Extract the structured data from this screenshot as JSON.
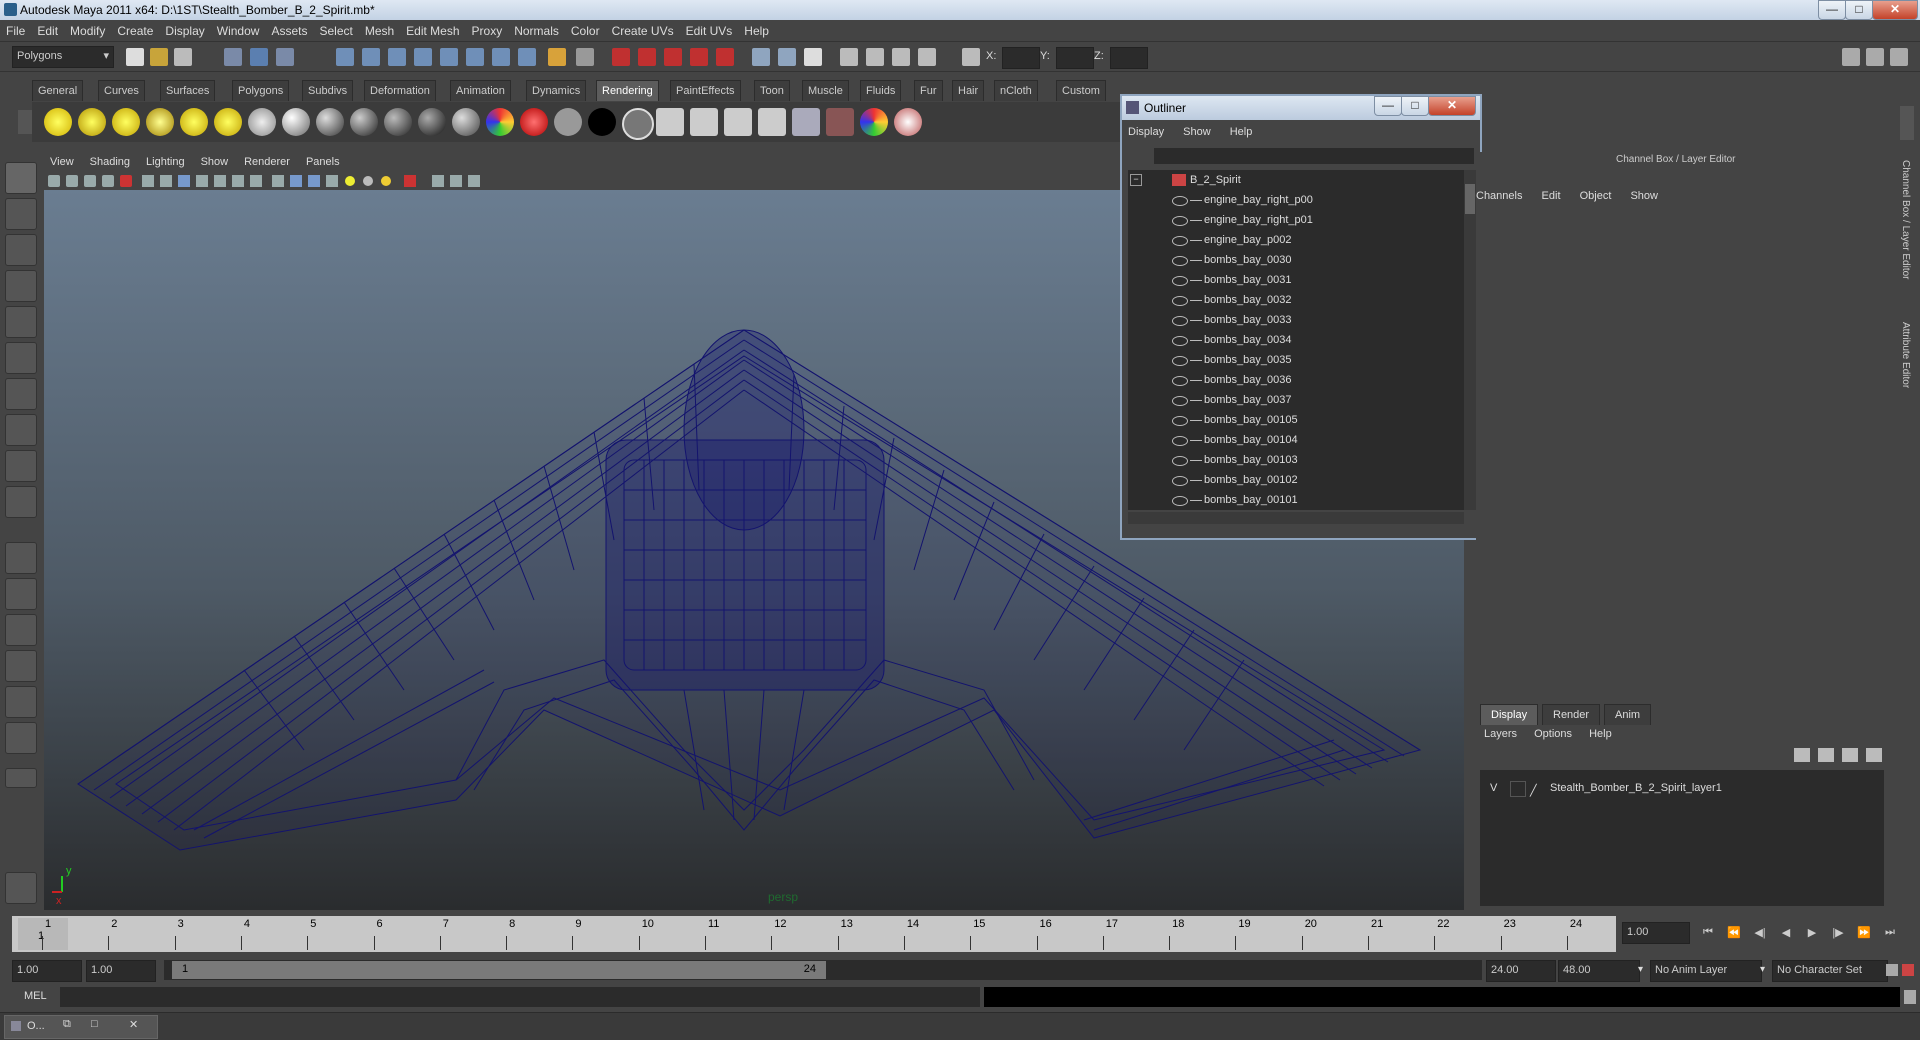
{
  "app": {
    "title": "Autodesk Maya 2011 x64: D:\\1ST\\Stealth_Bomber_B_2_Spirit.mb*",
    "min_label": "—",
    "max_label": "□",
    "close_label": "✕"
  },
  "menubar": [
    "File",
    "Edit",
    "Modify",
    "Create",
    "Display",
    "Window",
    "Assets",
    "Select",
    "Mesh",
    "Edit Mesh",
    "Proxy",
    "Normals",
    "Color",
    "Create UVs",
    "Edit UVs",
    "Help"
  ],
  "statusline": {
    "mode": "Polygons",
    "x_label": "X:",
    "y_label": "Y:",
    "z_label": "Z:"
  },
  "shelf_tabs": [
    "General",
    "Curves",
    "Surfaces",
    "Polygons",
    "Subdivs",
    "Deformation",
    "Animation",
    "Dynamics",
    "Rendering",
    "PaintEffects",
    "Toon",
    "Muscle",
    "Fluids",
    "Fur",
    "Hair",
    "nCloth",
    "Custom"
  ],
  "shelf_active": "Rendering",
  "viewport": {
    "menu": [
      "View",
      "Shading",
      "Lighting",
      "Show",
      "Renderer",
      "Panels"
    ],
    "camera": "persp",
    "axis_x": "x",
    "axis_y": "y"
  },
  "outliner": {
    "title": "Outliner",
    "menu": [
      "Display",
      "Show",
      "Help"
    ],
    "root": "B_2_Spirit",
    "items": [
      "engine_bay_right_p00",
      "engine_bay_right_p01",
      "engine_bay_p002",
      "bombs_bay_0030",
      "bombs_bay_0031",
      "bombs_bay_0032",
      "bombs_bay_0033",
      "bombs_bay_0034",
      "bombs_bay_0035",
      "bombs_bay_0036",
      "bombs_bay_0037",
      "bombs_bay_00105",
      "bombs_bay_00104",
      "bombs_bay_00103",
      "bombs_bay_00102",
      "bombs_bay_00101"
    ]
  },
  "channel_box": {
    "header": "Channel Box / Layer Editor",
    "menu": [
      "Channels",
      "Edit",
      "Object",
      "Show"
    ],
    "side_tabs": [
      "Channel Box / Layer Editor",
      "Attribute Editor"
    ]
  },
  "layer_editor": {
    "tabs": [
      "Display",
      "Render",
      "Anim"
    ],
    "active_tab": "Display",
    "menu": [
      "Layers",
      "Options",
      "Help"
    ],
    "layer_visible": "V",
    "layer_name": "Stealth_Bomber_B_2_Spirit_layer1"
  },
  "time_slider": {
    "labels": [
      "1",
      "2",
      "3",
      "4",
      "5",
      "6",
      "7",
      "8",
      "9",
      "10",
      "11",
      "12",
      "13",
      "14",
      "15",
      "16",
      "17",
      "18",
      "19",
      "20",
      "21",
      "22",
      "23",
      "24"
    ],
    "current_frame": "1",
    "current_time_field": "1.00"
  },
  "range_slider": {
    "start_time": "1.00",
    "playback_start": "1.00",
    "range_start_label": "1",
    "range_end_label": "24",
    "playback_end": "24.00",
    "end_time": "48.00",
    "anim_layer": "No Anim Layer",
    "character_set": "No Character Set"
  },
  "command_line": {
    "label": "MEL"
  },
  "taskbar": {
    "item": "O..."
  },
  "colors": {
    "wireframe": "#13136e",
    "viewport_top": "#6a7d91",
    "viewport_bottom": "#2a2c2e",
    "active_tab": "#5c5c5c"
  }
}
